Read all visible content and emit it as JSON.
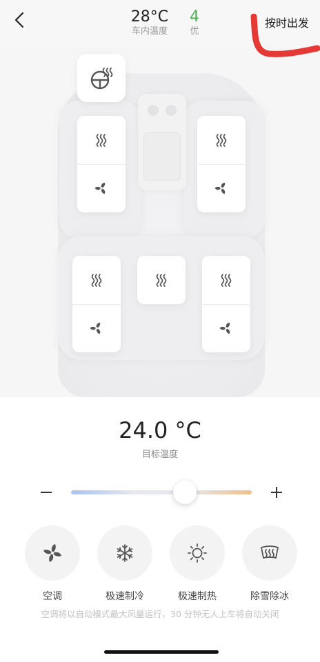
{
  "header": {
    "cabin_temp_value": "28°C",
    "cabin_temp_label": "车内温度",
    "air_quality_value": "4",
    "air_quality_label": "优",
    "depart_on_time": "按时出发",
    "back_icon": "chevron-left-icon",
    "accent_good": "#4caf50",
    "annotation_color": "#e53935"
  },
  "seats": {
    "steering_wheel_heat_icon": "steering-wheel-heat-icon",
    "front_left": {
      "heat_icon": "seat-heat-icon",
      "vent_icon": "fan-icon"
    },
    "front_right": {
      "heat_icon": "seat-heat-icon",
      "vent_icon": "fan-icon"
    },
    "rear_left": {
      "heat_icon": "seat-heat-icon",
      "vent_icon": "fan-icon"
    },
    "rear_center": {
      "heat_icon": "seat-heat-icon"
    },
    "rear_right": {
      "heat_icon": "seat-heat-icon",
      "vent_icon": "fan-icon"
    }
  },
  "climate": {
    "target_temp_value": "24.0 °C",
    "target_temp_label": "目标温度",
    "minus_icon": "minus-icon",
    "plus_icon": "plus-icon",
    "slider_fraction": 0.63,
    "slider_cold_color": "#a9c4ef",
    "slider_hot_color": "#efc08a"
  },
  "modes": [
    {
      "label": "空调",
      "icon": "fan-icon"
    },
    {
      "label": "极速制冷",
      "icon": "snowflake-icon"
    },
    {
      "label": "极速制热",
      "icon": "sun-icon"
    },
    {
      "label": "除雪除冰",
      "icon": "defrost-icon"
    }
  ],
  "hint": "空调将以自动模式最大风量运行，30 分钟无人上车将自动关闭"
}
